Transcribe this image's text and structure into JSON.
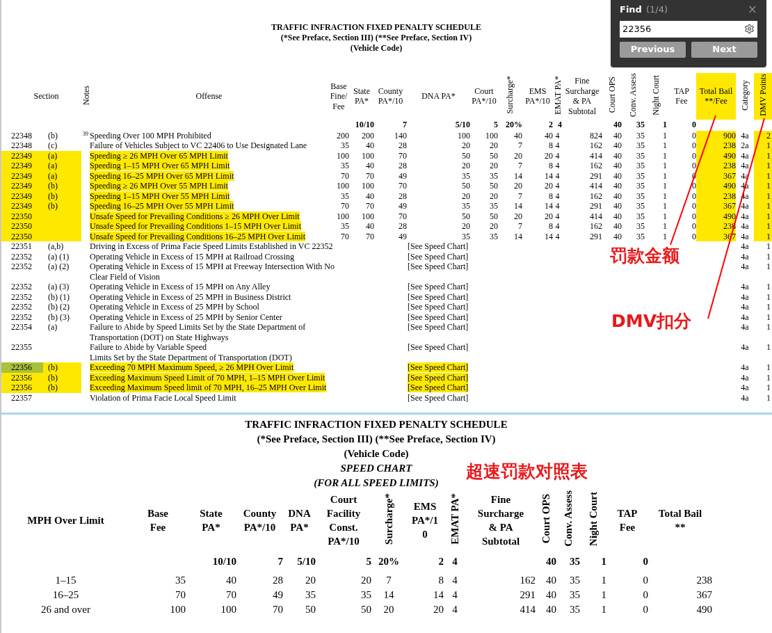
{
  "top_document": {
    "title_lines": [
      "TRAFFIC INFRACTION FIXED PENALTY SCHEDULE",
      "(*See Preface, Section III) (**See Preface, Section IV)",
      "(Vehicle Code)"
    ],
    "columns": [
      {
        "label": "Section",
        "vertical": false,
        "highlighted": false
      },
      {
        "label": "Notes",
        "vertical": true,
        "highlighted": false
      },
      {
        "label": "Offense",
        "vertical": false,
        "highlighted": false
      },
      {
        "label": "Base\nFine/\nFee",
        "vertical": false,
        "highlighted": false
      },
      {
        "label": "State\nPA*",
        "vertical": false,
        "highlighted": false
      },
      {
        "label": "County\nPA*/10",
        "vertical": false,
        "highlighted": false
      },
      {
        "label": "DNA PA*",
        "vertical": false,
        "highlighted": false
      },
      {
        "label": "Court\nPA*/10",
        "vertical": false,
        "highlighted": false
      },
      {
        "label": "Surcharge*",
        "vertical": true,
        "highlighted": false
      },
      {
        "label": "EMS\nPA*/10",
        "vertical": false,
        "highlighted": false
      },
      {
        "label": "EMAT PA*",
        "vertical": true,
        "highlighted": false
      },
      {
        "label": "Fine\nSurcharge\n& PA\nSubtotal",
        "vertical": false,
        "highlighted": false
      },
      {
        "label": "Court OPS",
        "vertical": true,
        "highlighted": false
      },
      {
        "label": "Conv. Assess",
        "vertical": true,
        "highlighted": false
      },
      {
        "label": "Night Court",
        "vertical": true,
        "highlighted": false
      },
      {
        "label": "TAP\nFee",
        "vertical": false,
        "highlighted": false
      },
      {
        "label": "Total Bail\n**/Fee",
        "vertical": false,
        "highlighted": true
      },
      {
        "label": "Category",
        "vertical": true,
        "highlighted": false
      },
      {
        "label": "DMV Points",
        "vertical": true,
        "highlighted": true
      }
    ],
    "rates": [
      "10/10",
      "7",
      "5/10",
      "5",
      "20%",
      "2",
      "4",
      "40",
      "35",
      "1",
      "0"
    ],
    "rows": [
      {
        "section": "22348",
        "sub": "(b)",
        "note": "39",
        "offense": [
          "Speeding Over 100 MPH Prohibited"
        ],
        "values": [
          "200",
          "200",
          "140",
          "100",
          "100",
          "40",
          "40",
          "4",
          "824",
          "40",
          "35",
          "1",
          "0",
          "900"
        ],
        "category": "4a",
        "points": "2",
        "highlighted": false,
        "current_match": false
      },
      {
        "section": "22348",
        "sub": "(c)",
        "offense": [
          "Failure of Vehicles Subject to VC 22406 to Use Designated Lane"
        ],
        "values": [
          "35",
          "40",
          "28",
          "20",
          "20",
          "7",
          "8",
          "4",
          "162",
          "40",
          "35",
          "1",
          "0",
          "238"
        ],
        "category": "2a",
        "points": "1",
        "highlighted": false,
        "current_match": false
      },
      {
        "section": "22349",
        "sub": "(a)",
        "offense": [
          "Speeding ≥ 26 MPH Over 65 MPH Limit"
        ],
        "values": [
          "100",
          "100",
          "70",
          "50",
          "50",
          "20",
          "20",
          "4",
          "414",
          "40",
          "35",
          "1",
          "0",
          "490"
        ],
        "category": "4a",
        "points": "1",
        "highlighted": true,
        "current_match": false
      },
      {
        "section": "22349",
        "sub": "(a)",
        "offense": [
          "Speeding 1–15 MPH Over 65 MPH Limit"
        ],
        "values": [
          "35",
          "40",
          "28",
          "20",
          "20",
          "7",
          "8",
          "4",
          "162",
          "40",
          "35",
          "1",
          "0",
          "238"
        ],
        "category": "4a",
        "points": "1",
        "highlighted": true,
        "current_match": false
      },
      {
        "section": "22349",
        "sub": "(a)",
        "offense": [
          "Speeding 16–25 MPH Over 65 MPH Limit"
        ],
        "values": [
          "70",
          "70",
          "49",
          "35",
          "35",
          "14",
          "14",
          "4",
          "291",
          "40",
          "35",
          "1",
          "0",
          "367"
        ],
        "category": "4a",
        "points": "1",
        "highlighted": true,
        "current_match": false
      },
      {
        "section": "22349",
        "sub": "(b)",
        "offense": [
          "Speeding ≥ 26 MPH Over 55 MPH Limit"
        ],
        "values": [
          "100",
          "100",
          "70",
          "50",
          "50",
          "20",
          "20",
          "4",
          "414",
          "40",
          "35",
          "1",
          "0",
          "490"
        ],
        "category": "4a",
        "points": "1",
        "highlighted": true,
        "current_match": false
      },
      {
        "section": "22349",
        "sub": "(b)",
        "offense": [
          "Speeding 1–15 MPH Over 55 MPH Limit"
        ],
        "values": [
          "35",
          "40",
          "28",
          "20",
          "20",
          "7",
          "8",
          "4",
          "162",
          "40",
          "35",
          "1",
          "0",
          "238"
        ],
        "category": "4a",
        "points": "1",
        "highlighted": true,
        "current_match": false
      },
      {
        "section": "22349",
        "sub": "(b)",
        "offense": [
          "Speeding 16–25 MPH Over 55 MPH Limit"
        ],
        "values": [
          "70",
          "70",
          "49",
          "35",
          "35",
          "14",
          "14",
          "4",
          "291",
          "40",
          "35",
          "1",
          "0",
          "367"
        ],
        "category": "4a",
        "points": "1",
        "highlighted": true,
        "current_match": false
      },
      {
        "section": "22350",
        "offense": [
          "Unsafe Speed for Prevailing Conditions ≥ 26 MPH Over Limit"
        ],
        "values": [
          "100",
          "100",
          "70",
          "50",
          "50",
          "20",
          "20",
          "4",
          "414",
          "40",
          "35",
          "1",
          "0",
          "490"
        ],
        "category": "4a",
        "points": "1",
        "highlighted": true,
        "current_match": false
      },
      {
        "section": "22350",
        "offense": [
          "Unsafe Speed for Prevailing Conditions 1–15 MPH Over Limit"
        ],
        "values": [
          "35",
          "40",
          "28",
          "20",
          "20",
          "7",
          "8",
          "4",
          "162",
          "40",
          "35",
          "1",
          "0",
          "238"
        ],
        "category": "4a",
        "points": "1",
        "highlighted": true,
        "current_match": false
      },
      {
        "section": "22350",
        "offense": [
          "Unsafe Speed for Prevailing Conditions 16–25 MPH Over Limit"
        ],
        "values": [
          "70",
          "70",
          "49",
          "35",
          "35",
          "14",
          "14",
          "4",
          "291",
          "40",
          "35",
          "1",
          "0",
          "367"
        ],
        "category": "4a",
        "points": "1",
        "highlighted": true,
        "current_match": false
      },
      {
        "section": "22351",
        "sub": "(a,b)",
        "offense": [
          "Driving in Excess of Prima Facie Speed Limits Established in VC 22352"
        ],
        "reference": "[See Speed Chart]",
        "category": "4a",
        "points": "1",
        "highlighted": false,
        "current_match": false
      },
      {
        "section": "22352",
        "sub": "(a) (1)",
        "offense": [
          "Operating Vehicle in Excess of 15 MPH  at Railroad Crossing"
        ],
        "reference": "[See Speed Chart]",
        "category": "4a",
        "points": "1",
        "highlighted": false,
        "current_match": false
      },
      {
        "section": "22352",
        "sub": "(a) (2)",
        "offense": [
          "Operating Vehicle in Excess of 15 MPH at Freeway Intersection With No",
          "Clear Field of Vision"
        ],
        "reference": "[See Speed Chart]",
        "category": "4a",
        "points": "1",
        "highlighted": false,
        "current_match": false
      },
      {
        "section": "22352",
        "sub": "(a) (3)",
        "offense": [
          "Operating Vehicle in Excess of 15 MPH on Any Alley"
        ],
        "reference": "[See Speed Chart]",
        "category": "4a",
        "points": "1",
        "highlighted": false,
        "current_match": false
      },
      {
        "section": "22352",
        "sub": "(b) (1)",
        "offense": [
          "Operating Vehicle in Excess of 25 MPH in Business District"
        ],
        "reference": "[See Speed Chart]",
        "category": "4a",
        "points": "1",
        "highlighted": false,
        "current_match": false
      },
      {
        "section": "22352",
        "sub": "(b) (2)",
        "offense": [
          "Operating Vehicle in Excess of 25 MPH by School"
        ],
        "reference": "[See Speed Chart]",
        "category": "4a",
        "points": "1",
        "highlighted": false,
        "current_match": false
      },
      {
        "section": "22352",
        "sub": "(b) (3)",
        "offense": [
          "Operating Vehicle in Excess of 25 MPH by Senior Center"
        ],
        "reference": "[See Speed Chart]",
        "category": "4a",
        "points": "1",
        "highlighted": false,
        "current_match": false
      },
      {
        "section": "22354",
        "sub": "(a)",
        "offense": [
          "Failure to Abide by Speed Limits Set by the State Department of",
          "Transportation (DOT) on State Highways"
        ],
        "reference": "[See Speed Chart]",
        "category": "4a",
        "points": "1",
        "highlighted": false,
        "current_match": false
      },
      {
        "section": "22355",
        "offense": [
          "Failure to Abide by Variable Speed",
          "Limits Set by the State Department of Transportation (DOT)"
        ],
        "reference": "[See Speed Chart]",
        "category": "4a",
        "points": "1",
        "highlighted": false,
        "current_match": false
      },
      {
        "section": "22356",
        "sub": "(b)",
        "offense": [
          "Exceeding 70 MPH Maximum Speed, ≥ 26 MPH Over Limit"
        ],
        "reference": "[See Speed Chart]",
        "category": "4a",
        "points": "1",
        "highlighted": true,
        "current_match": true
      },
      {
        "section": "22356",
        "sub": "(b)",
        "offense": [
          "Exceeding Maximum Speed Limit of 70 MPH, 1–15 MPH Over Limit"
        ],
        "reference": "[See Speed Chart]",
        "category": "4a",
        "points": "1",
        "highlighted": true,
        "current_match": false
      },
      {
        "section": "22356",
        "sub": "(b)",
        "offense": [
          "Exceeding Maximum Speed limit of 70 MPH, 16–25 MPH Over Limit"
        ],
        "reference": "[See Speed Chart]",
        "category": "4a",
        "points": "1",
        "highlighted": true,
        "current_match": false
      },
      {
        "section": "22357",
        "offense": [
          "Violation of Prima Facie Local Speed Limit"
        ],
        "reference": "[See Speed Chart]",
        "category": "4a",
        "points": "1",
        "highlighted": false,
        "current_match": false
      }
    ]
  },
  "speed_chart": {
    "title_lines": [
      "TRAFFIC INFRACTION FIXED PENALTY SCHEDULE",
      "(*See Preface, Section III) (**See Preface, Section IV)",
      "(Vehicle Code)"
    ],
    "subtitle_lines": [
      "SPEED CHART",
      "(FOR ALL SPEED LIMITS)"
    ],
    "columns": [
      {
        "label": "MPH Over Limit",
        "vertical": false
      },
      {
        "label": "Base\nFee",
        "vertical": false
      },
      {
        "label": "State\nPA*",
        "vertical": false
      },
      {
        "label": "County\nPA*/10",
        "vertical": false
      },
      {
        "label": "DNA\nPA*",
        "vertical": false
      },
      {
        "label": "Court\nFacility\nConst.\nPA*/10",
        "vertical": false
      },
      {
        "label": "Surcharge*",
        "vertical": true
      },
      {
        "label": "EMS\nPA*/1\n0",
        "vertical": false
      },
      {
        "label": "EMAT PA*",
        "vertical": true
      },
      {
        "label": "Fine\nSurcharge\n& PA\nSubtotal",
        "vertical": false
      },
      {
        "label": "Court OPS",
        "vertical": true
      },
      {
        "label": "Conv. Assess",
        "vertical": true
      },
      {
        "label": "Night Court",
        "vertical": true
      },
      {
        "label": "TAP\nFee",
        "vertical": false
      },
      {
        "label": "Total Bail\n**",
        "vertical": false
      }
    ],
    "rates": [
      "10/10",
      "7",
      "5/10",
      "5",
      "20%",
      "2",
      "4",
      "40",
      "35",
      "1",
      "0"
    ],
    "rows": [
      {
        "range": "1–15",
        "values": [
          "35",
          "40",
          "28",
          "20",
          "20",
          "7",
          "8",
          "4",
          "162",
          "40",
          "35",
          "1",
          "0",
          "238"
        ]
      },
      {
        "range": "16–25",
        "values": [
          "70",
          "70",
          "49",
          "35",
          "35",
          "14",
          "14",
          "4",
          "291",
          "40",
          "35",
          "1",
          "0",
          "367"
        ]
      },
      {
        "range": "26 and over",
        "values": [
          "100",
          "100",
          "70",
          "50",
          "50",
          "20",
          "20",
          "4",
          "414",
          "40",
          "35",
          "1",
          "0",
          "490"
        ]
      }
    ]
  },
  "annotations": {
    "total_bail_note": "罚款金额",
    "dmv_points_note": "DMV扣分",
    "speed_chart_note": "超速罚款对照表"
  },
  "find_bar": {
    "title": "Find",
    "count": "(1/4)",
    "close": "×",
    "query": "22356",
    "buttons": [
      "Previous",
      "Next"
    ]
  }
}
